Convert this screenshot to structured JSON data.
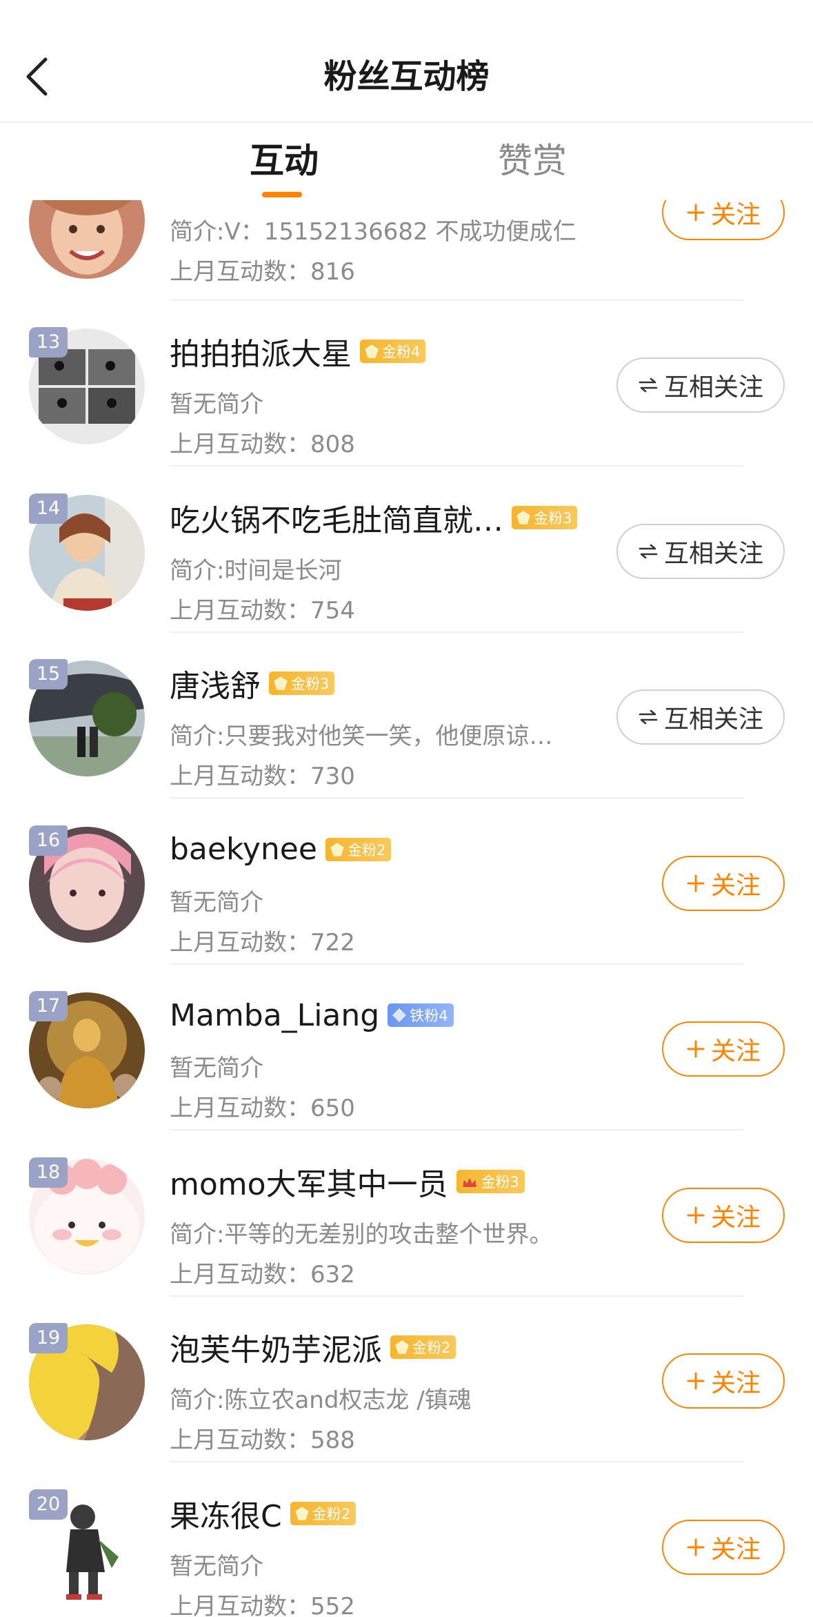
{
  "header": {
    "title": "粉丝互动榜"
  },
  "tabs": [
    {
      "label": "互动",
      "active": true
    },
    {
      "label": "赞赏",
      "active": false
    }
  ],
  "colors": {
    "accent": "#ff8200",
    "gold_badge": "#f7b52c",
    "iron_badge": "#6b96f0",
    "rank_bg": "#9aa3c6"
  },
  "partial_row": {
    "bio": "简介:V：15152136682 不成功便成仁",
    "count": "上月互动数：816",
    "button_label": "关注"
  },
  "fans": [
    {
      "rank": "13",
      "name": "拍拍拍派大星",
      "badge": "金粉4",
      "badge_type": "gold",
      "bio": "暂无简介",
      "count": "上月互动数：808",
      "button": "互相关注",
      "button_style": "mutual"
    },
    {
      "rank": "14",
      "name": "吃火锅不吃毛肚简直就…",
      "badge": "金粉3",
      "badge_type": "gold",
      "bio": "简介:时间是长河",
      "count": "上月互动数：754",
      "button": "互相关注",
      "button_style": "mutual"
    },
    {
      "rank": "15",
      "name": "唐浅舒",
      "badge": "金粉3",
      "badge_type": "gold",
      "bio": "简介:只要我对他笑一笑，他便原谅…",
      "count": "上月互动数：730",
      "button": "互相关注",
      "button_style": "mutual"
    },
    {
      "rank": "16",
      "name": "baekynee",
      "badge": "金粉2",
      "badge_type": "gold",
      "bio": "暂无简介",
      "count": "上月互动数：722",
      "button": "关注",
      "button_style": "follow"
    },
    {
      "rank": "17",
      "name": "Mamba_Liang",
      "badge": "铁粉4",
      "badge_type": "iron",
      "bio": "暂无简介",
      "count": "上月互动数：650",
      "button": "关注",
      "button_style": "follow"
    },
    {
      "rank": "18",
      "name": "momo大军其中一员",
      "badge": "金粉3",
      "badge_type": "gold-crown",
      "bio": "简介:平等的无差别的攻击整个世界。",
      "count": "上月互动数：632",
      "button": "关注",
      "button_style": "follow"
    },
    {
      "rank": "19",
      "name": "泡芙牛奶芋泥派",
      "badge": "金粉2",
      "badge_type": "gold",
      "bio": "简介:陈立农and权志龙 /镇魂",
      "count": "上月互动数：588",
      "button": "关注",
      "button_style": "follow"
    },
    {
      "rank": "20",
      "name": "果冻很C",
      "badge": "金粉2",
      "badge_type": "gold",
      "bio": "暂无简介",
      "count": "上月互动数：552",
      "button": "关注",
      "button_style": "follow"
    }
  ]
}
